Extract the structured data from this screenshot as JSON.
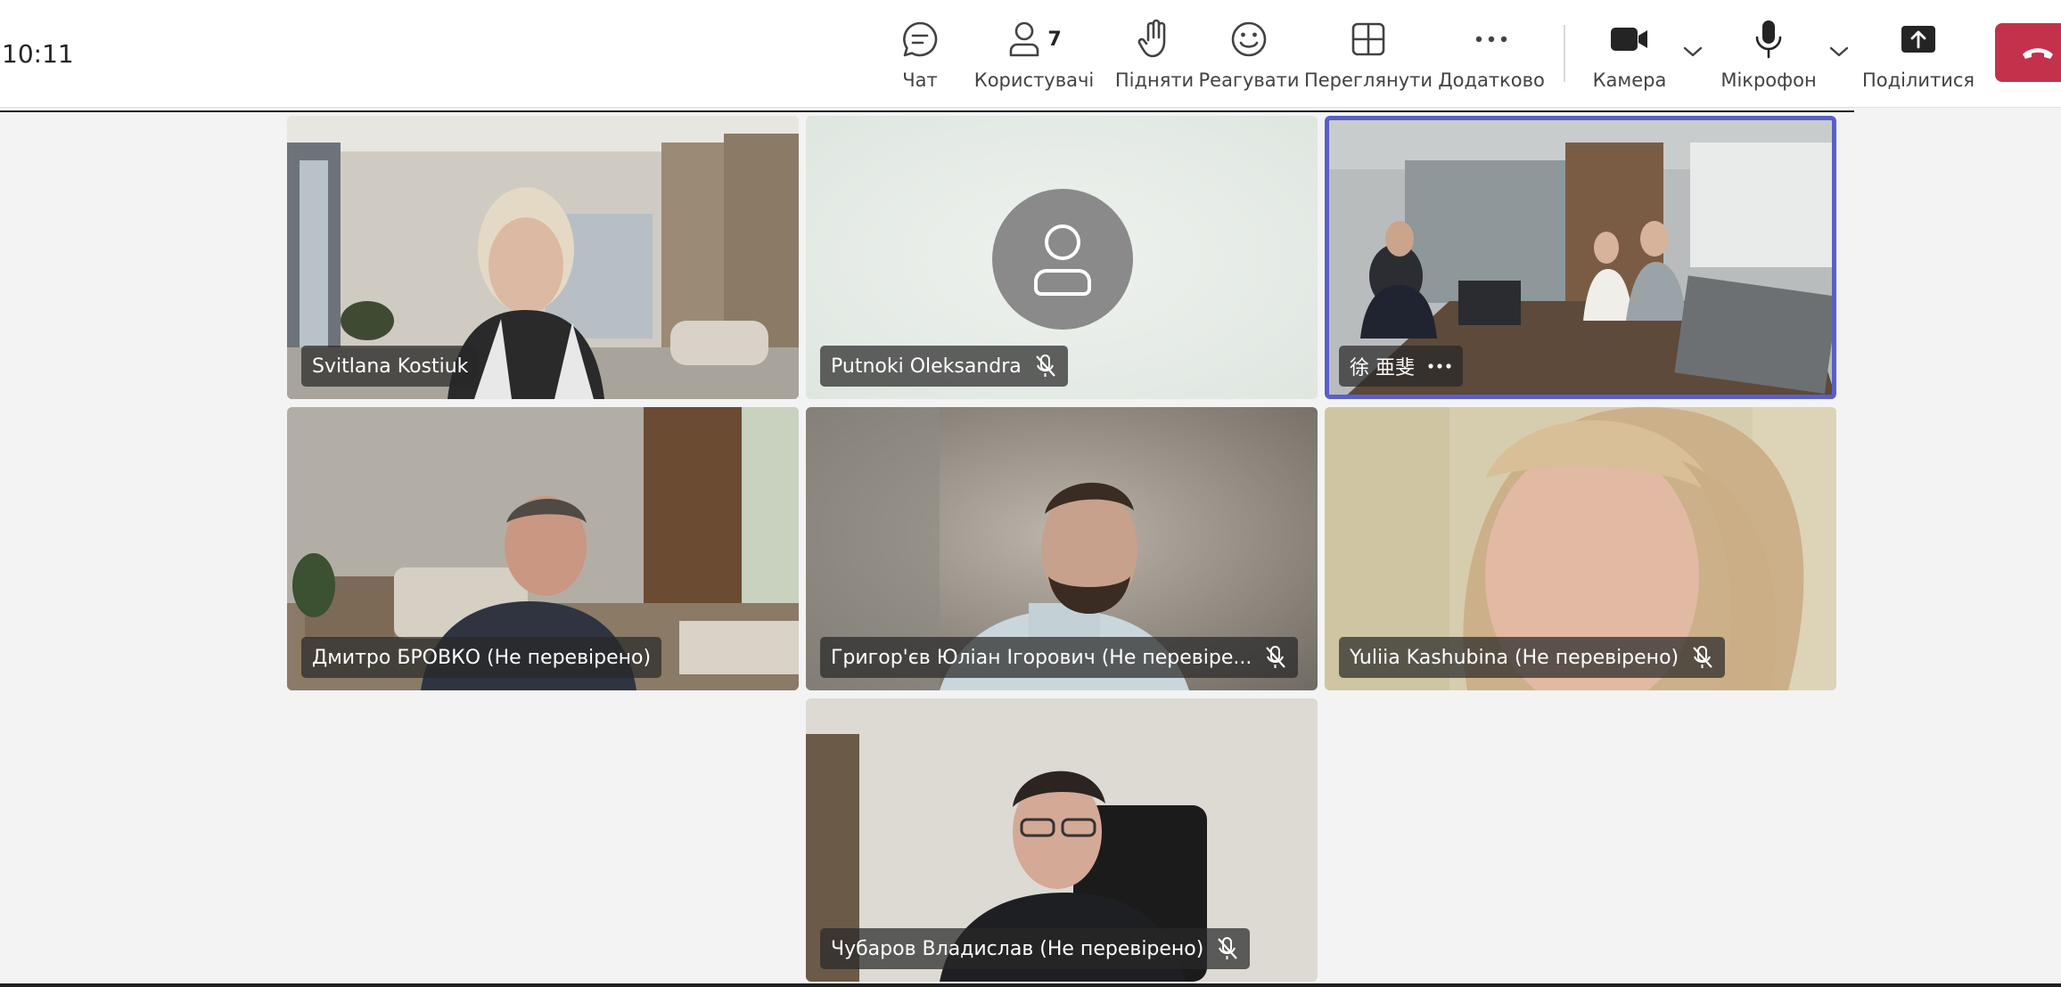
{
  "clock": "10:11",
  "toolbar": {
    "chat": "Чат",
    "people": "Користувачі",
    "people_count": "7",
    "raise": "Підняти",
    "react": "Реагувати",
    "view": "Переглянути",
    "more": "Додатково",
    "camera": "Камера",
    "mic": "Мікрофон",
    "share": "Поділитися"
  },
  "icons": {
    "chat": "chat-icon",
    "people": "people-icon",
    "raise": "raise-hand-icon",
    "react": "smiley-icon",
    "view": "grid-view-icon",
    "more": "more-icon",
    "camera": "camera-icon",
    "mic": "microphone-icon",
    "share": "share-screen-icon",
    "hangup": "hang-up-icon"
  },
  "colors": {
    "accent": "#5b5fc7",
    "hangup": "#c4314b"
  },
  "participants": [
    {
      "name": "Svitlana Kostiuk",
      "muted": false
    },
    {
      "name": "Putnoki Oleksandra",
      "muted": true
    },
    {
      "name": "徐 亜斐",
      "muted": false,
      "active": true
    },
    {
      "name": "Дмитро БРОВКО (Не перевірено)",
      "muted": false
    },
    {
      "name": "Григор'єв Юліан Ігорович (Не перевіре...",
      "muted": true
    },
    {
      "name": "Yuliia Kashubina (Не перевірено)",
      "muted": true
    },
    {
      "name": "Чубаров Владислав (Не перевірено)",
      "muted": true
    }
  ]
}
